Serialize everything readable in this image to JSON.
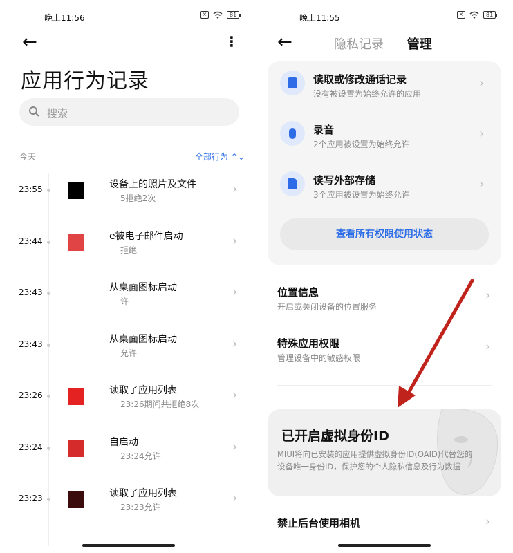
{
  "left": {
    "status": {
      "time": "晚上11:56",
      "battery": "81"
    },
    "title": "应用行为记录",
    "search_placeholder": "搜索",
    "day_label": "今天",
    "filter_label": "全部行为 ⌃⌄",
    "records": [
      {
        "time": "23:55",
        "action": "设备上的照片及文件",
        "detail": "5拒绝2次",
        "color": "#000000"
      },
      {
        "time": "23:44",
        "action": "e被电子邮件启动",
        "detail": "拒绝",
        "color": "#e04444"
      },
      {
        "time": "23:43",
        "action": "从桌面图标启动",
        "detail": "许",
        "color": "#ffffff"
      },
      {
        "time": "23:43",
        "action": "从桌面图标启动",
        "detail": "允许",
        "color": "#ffffff"
      },
      {
        "time": "23:26",
        "action": "读取了应用列表",
        "detail": "23:26期间共拒绝8次",
        "color": "#e52222"
      },
      {
        "time": "23:24",
        "action": "自启动",
        "detail": "23:24允许",
        "color": "#d62b2b"
      },
      {
        "time": "23:23",
        "action": "读取了应用列表",
        "detail": "23:23允许",
        "color": "#3a0c0c"
      }
    ]
  },
  "right": {
    "status": {
      "time": "晚上11:55",
      "battery": "81"
    },
    "tab_privacy": "隐私记录",
    "tab_manage": "管理",
    "permissions": [
      {
        "name": "读取或修改通话记录",
        "sub": "没有被设置为始终允许的应用",
        "icon": "call-log-icon"
      },
      {
        "name": "录音",
        "sub": "2个应用被设置为始终允许",
        "icon": "microphone-icon"
      },
      {
        "name": "读写外部存储",
        "sub": "3个应用被设置为始终允许",
        "icon": "storage-icon"
      }
    ],
    "view_all": "查看所有权限使用状态",
    "location": {
      "name": "位置信息",
      "sub": "开启或关闭设备的位置服务"
    },
    "special": {
      "name": "特殊应用权限",
      "sub": "管理设备中的敏感权限"
    },
    "oaid": {
      "title": "已开启虚拟身份ID",
      "desc": "MIUI将向已安装的应用提供虚拟身份ID(OAID)代替您的设备唯一身份ID，保护您的个人隐私信息及行为数据"
    },
    "camera": {
      "name": "禁止后台使用相机"
    }
  },
  "colors": {
    "accent": "#2b6de8",
    "annotation_arrow": "#c0221c"
  }
}
